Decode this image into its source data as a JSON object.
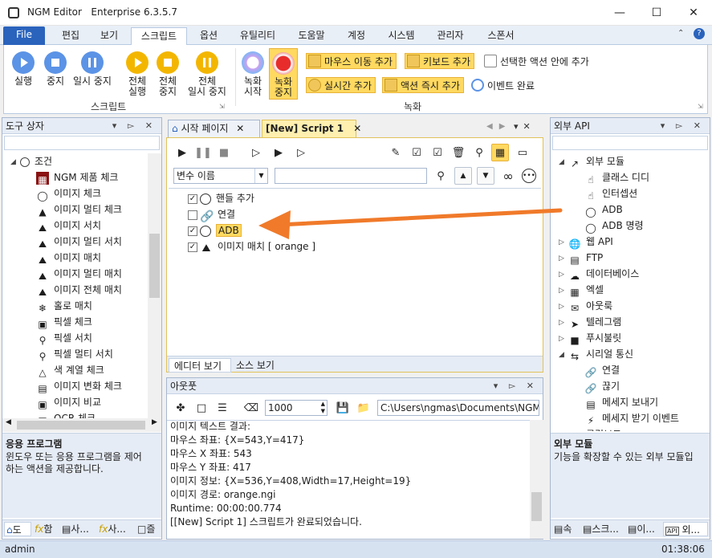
{
  "window": {
    "title": "NGM Editor",
    "edition": "Enterprise 6.3.5.7"
  },
  "menu": {
    "file": "File",
    "tabs": [
      "편집",
      "보기",
      "스크립트",
      "옵션",
      "유틸리티",
      "도움말",
      "계정",
      "시스템",
      "관리자",
      "스폰서"
    ]
  },
  "ribbon": {
    "run": "실행",
    "stop": "중지",
    "pause": "일시 중지",
    "run_all_1": "전체",
    "run_all_2": "실행",
    "stop_all_1": "전체",
    "stop_all_2": "중지",
    "pause_all_1": "전체",
    "pause_all_2": "일시 중지",
    "script_group": "스크립트",
    "rec_start_1": "녹화",
    "rec_start_2": "시작",
    "rec_stop_1": "녹화",
    "rec_stop_2": "중지",
    "mouse_move": "마우스 이동 추가",
    "keyboard_add": "키보드 추가",
    "in_selected": "선택한 액션 안에 추가",
    "realtime_add": "실시간 추가",
    "instant_add": "액션 즉시 추가",
    "event_done": "이벤트 완료",
    "rec_group": "녹화"
  },
  "toolbox": {
    "title": "도구 상자",
    "root": "조건",
    "items": [
      "NGM 제품 체크",
      "이미지 체크",
      "이미지 멀티 체크",
      "이미지 서치",
      "이미지 멀티 서치",
      "이미지 매치",
      "이미지 멀티 매치",
      "이미지 전체 매치",
      "홀로 매치",
      "픽셀 체크",
      "픽셀 서치",
      "픽셀 멀티 서치",
      "색 계열 체크",
      "이미지 변화 체크",
      "이미지 비교",
      "OCR 체크"
    ],
    "desc_title": "응용 프로그램",
    "desc_text_1": "윈도우 또는 응용 프로그램을 제어",
    "desc_text_2": "하는 액션을 제공합니다.",
    "bottom_tabs": [
      "도",
      "함",
      "사...",
      "사...",
      "즐"
    ]
  },
  "editor": {
    "tab_start": "시작 페이지",
    "tab_script": "[New] Script 1",
    "var_placeholder": "변수 이름",
    "actions": [
      {
        "label": "핸들 추가",
        "checked": true
      },
      {
        "label": "연결",
        "checked": false
      },
      {
        "label": "ADB",
        "checked": true
      },
      {
        "label": "이미지 매치 [ orange ]",
        "checked": true
      }
    ],
    "view_editor": "에디터 보기",
    "view_source": "소스 보기"
  },
  "output": {
    "title": "아웃풋",
    "count": "1000",
    "path": "C:\\Users\\ngmas\\Documents\\NGM6\\",
    "lines": [
      "이미지 텍스트 결과:",
      "마우스 좌표: {X=543,Y=417}",
      "마우스 X 좌표: 543",
      "마우스 Y 좌표: 417",
      "이미지 정보: {X=536,Y=408,Width=17,Height=19}",
      "이미지 경로: orange.ngi",
      "Runtime: 00:00:00.774",
      "[[New] Script 1] 스크립트가 완료되었습니다."
    ]
  },
  "external": {
    "title": "외부 API",
    "modules": "외부 모듈",
    "module_items": [
      "클래스 디디",
      "인터셉션",
      "ADB",
      "ADB 명령"
    ],
    "groups": [
      "웹 API",
      "FTP",
      "데이터베이스",
      "엑셀",
      "아웃룩",
      "텔레그램",
      "푸시불릿"
    ],
    "serial": "시리얼 통신",
    "serial_items": [
      "연결",
      "끊기",
      "메세지 보내기",
      "메세지 받기 이벤트"
    ],
    "last": "클립보드",
    "desc_title": "외부 모듈",
    "desc_text": "기능을 확장할 수 있는 외부 모듈입",
    "bottom_tabs": [
      "속",
      "스크...",
      "이...",
      "외..."
    ]
  },
  "status": {
    "user": "admin",
    "time": "01:38:06"
  },
  "colors": {
    "accent": "#2a63bc",
    "highlight": "#ffd960",
    "arrow": "#f07a2a"
  }
}
